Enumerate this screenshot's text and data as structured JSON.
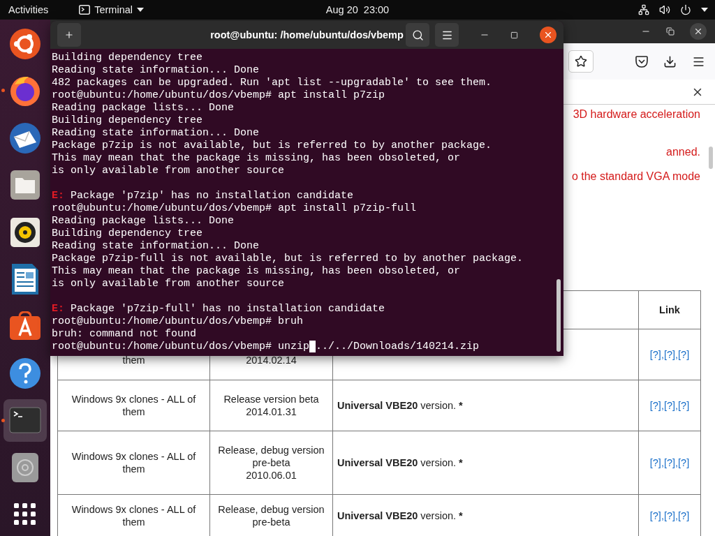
{
  "top_bar": {
    "activities": "Activities",
    "app_menu": "Terminal",
    "clock": "Aug 20  23:00"
  },
  "dock": {
    "items": [
      {
        "kind": "ubuntu",
        "running": false,
        "selected": false
      },
      {
        "kind": "firefox",
        "running": true,
        "selected": false
      },
      {
        "kind": "mail",
        "running": false,
        "selected": false
      },
      {
        "kind": "files",
        "running": false,
        "selected": false
      },
      {
        "kind": "music",
        "running": false,
        "selected": false
      },
      {
        "kind": "writer",
        "running": false,
        "selected": false
      },
      {
        "kind": "store",
        "running": false,
        "selected": false
      },
      {
        "kind": "help",
        "running": false,
        "selected": false
      },
      {
        "kind": "terminal",
        "running": true,
        "selected": true
      },
      {
        "kind": "disc",
        "running": false,
        "selected": false
      },
      {
        "kind": "apps",
        "running": false,
        "selected": false
      }
    ]
  },
  "browser": {
    "notice_lines": [
      "3D hardware acceleration",
      "anned.",
      "o the standard VGA mode"
    ],
    "table": {
      "link_header": "Link",
      "link_separator": ",",
      "rows": [
        {
          "system": "them",
          "release": [
            "2014.02.14"
          ],
          "links": [
            "[?]",
            "[?]",
            "[?]"
          ]
        },
        {
          "system": "Windows 9x clones - ALL of them",
          "release": [
            "Release version beta",
            "2014.01.31"
          ],
          "name": "Universal VBE20",
          "desc": "version.",
          "mark": "*",
          "links": [
            "[?]",
            "[?]",
            "[?]"
          ]
        },
        {
          "system": "Windows 9x clones - ALL of them",
          "release": [
            "Release, debug version",
            "pre-beta",
            "2010.06.01"
          ],
          "name": "Universal VBE20",
          "desc": "version.",
          "mark": "*",
          "links": [
            "[?]",
            "[?]",
            "[?]"
          ]
        },
        {
          "system": "Windows 9x clones - ALL of them",
          "release": [
            "Release, debug version",
            "pre-beta"
          ],
          "name": "Universal VBE20",
          "desc": "version.",
          "mark": "*",
          "links": [
            "[?]",
            "[?]",
            "[?]"
          ]
        }
      ]
    }
  },
  "terminal": {
    "title": "root@ubuntu: /home/ubuntu/dos/vbemp",
    "lines": [
      {
        "kind": "text",
        "text": "Building dependency tree"
      },
      {
        "kind": "text",
        "text": "Reading state information... Done"
      },
      {
        "kind": "text",
        "text": "482 packages can be upgraded. Run 'apt list --upgradable' to see them."
      },
      {
        "kind": "text",
        "text": "root@ubuntu:/home/ubuntu/dos/vbemp# apt install p7zip"
      },
      {
        "kind": "text",
        "text": "Reading package lists... Done"
      },
      {
        "kind": "text",
        "text": "Building dependency tree"
      },
      {
        "kind": "text",
        "text": "Reading state information... Done"
      },
      {
        "kind": "text",
        "text": "Package p7zip is not available, but is referred to by another package."
      },
      {
        "kind": "text",
        "text": "This may mean that the package is missing, has been obsoleted, or"
      },
      {
        "kind": "text",
        "text": "is only available from another source"
      },
      {
        "kind": "blank"
      },
      {
        "kind": "error",
        "prefix": "E:",
        "text": "Package 'p7zip' has no installation candidate"
      },
      {
        "kind": "text",
        "text": "root@ubuntu:/home/ubuntu/dos/vbemp# apt install p7zip-full"
      },
      {
        "kind": "text",
        "text": "Reading package lists... Done"
      },
      {
        "kind": "text",
        "text": "Building dependency tree"
      },
      {
        "kind": "text",
        "text": "Reading state information... Done"
      },
      {
        "kind": "text",
        "text": "Package p7zip-full is not available, but is referred to by another package."
      },
      {
        "kind": "text",
        "text": "This may mean that the package is missing, has been obsoleted, or"
      },
      {
        "kind": "text",
        "text": "is only available from another source"
      },
      {
        "kind": "blank"
      },
      {
        "kind": "error",
        "prefix": "E:",
        "text": "Package 'p7zip-full' has no installation candidate"
      },
      {
        "kind": "text",
        "text": "root@ubuntu:/home/ubuntu/dos/vbemp# bruh"
      },
      {
        "kind": "text",
        "text": "bruh: command not found"
      },
      {
        "kind": "cursor",
        "text": "root@ubuntu:/home/ubuntu/dos/vbemp# unzip",
        "after": "../../Downloads/140214.zip"
      }
    ]
  }
}
